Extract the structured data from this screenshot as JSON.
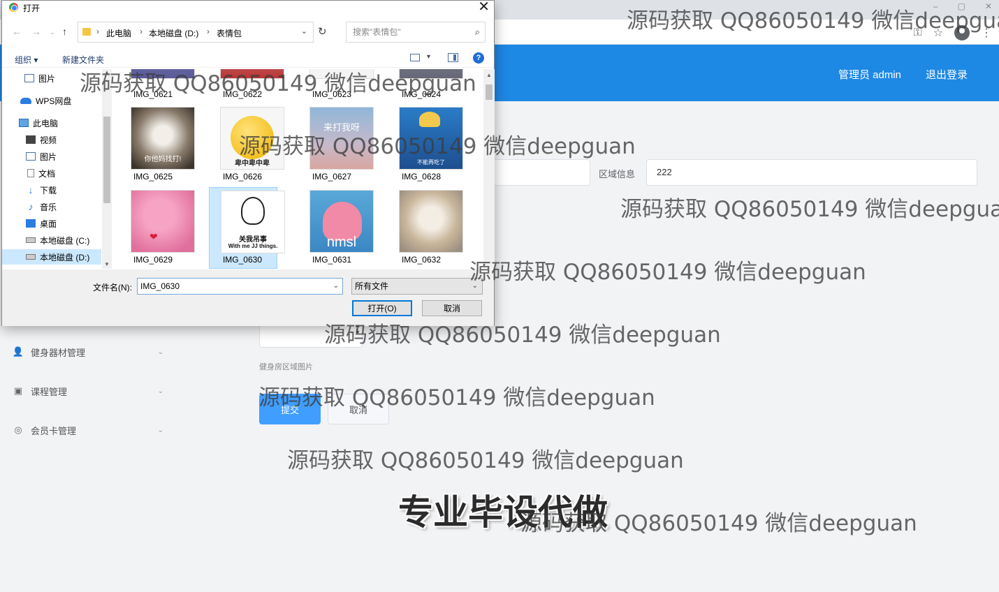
{
  "browser": {
    "window_controls": [
      "–",
      "▢",
      "✕"
    ],
    "icons": [
      "key-icon",
      "star-icon",
      "profile-icon",
      "menu-icon"
    ]
  },
  "header": {
    "user_label": "管理员 admin",
    "logout_label": "退出登录",
    "bg_color": "#1e88e5"
  },
  "sidebar": {
    "items": [
      {
        "label": "健身器材管理",
        "icon": "user-icon"
      },
      {
        "label": "课程管理",
        "icon": "clipboard-icon"
      },
      {
        "label": "会员卡管理",
        "icon": "card-icon"
      }
    ]
  },
  "form": {
    "area_label": "区域信息",
    "area_value": "222",
    "image_label": "健身房区域图片",
    "submit_label": "提交",
    "cancel_label": "取消"
  },
  "dialog": {
    "title": "打开",
    "breadcrumb": [
      "此电脑",
      "本地磁盘 (D:)",
      "表情包"
    ],
    "search_placeholder": "搜索\"表情包\"",
    "toolbar": {
      "organize": "组织 ▾",
      "new_folder": "新建文件夹",
      "help": "?"
    },
    "nav_items": [
      {
        "label": "图片",
        "icon": "pictures-icon"
      },
      {
        "label": "WPS网盘",
        "icon": "cloud-icon"
      },
      {
        "label": "此电脑",
        "icon": "computer-icon"
      },
      {
        "label": "视频",
        "icon": "video-icon"
      },
      {
        "label": "图片",
        "icon": "pictures-icon"
      },
      {
        "label": "文档",
        "icon": "document-icon"
      },
      {
        "label": "下载",
        "icon": "download-icon"
      },
      {
        "label": "音乐",
        "icon": "music-icon"
      },
      {
        "label": "桌面",
        "icon": "desktop-icon"
      },
      {
        "label": "本地磁盘 (C:)",
        "icon": "drive-icon"
      },
      {
        "label": "本地磁盘 (D:)",
        "icon": "drive-icon",
        "selected": true
      }
    ],
    "files": [
      {
        "name": "IMG_0621"
      },
      {
        "name": "IMG_0622"
      },
      {
        "name": "IMG_0623"
      },
      {
        "name": "IMG_0624"
      },
      {
        "name": "IMG_0625",
        "caption": "你他妈找打!"
      },
      {
        "name": "IMG_0626",
        "caption": "卑中卑中卑"
      },
      {
        "name": "IMG_0627",
        "caption": "来打我呀"
      },
      {
        "name": "IMG_0628",
        "caption": "不能再吃了"
      },
      {
        "name": "IMG_0629"
      },
      {
        "name": "IMG_0630",
        "caption": "关我吊事",
        "caption2": "With me JJ things.",
        "selected": true
      },
      {
        "name": "IMG_0631",
        "caption": "nmsl"
      },
      {
        "name": "IMG_0632"
      }
    ],
    "filename_label": "文件名(N):",
    "filename_value": "IMG_0630",
    "filetype_value": "所有文件",
    "open_label": "打开(O)",
    "cancel_label": "取消"
  },
  "watermarks": {
    "text": "源码获取 QQ86050149 微信deepguan",
    "promo": "专业毕设代做"
  }
}
